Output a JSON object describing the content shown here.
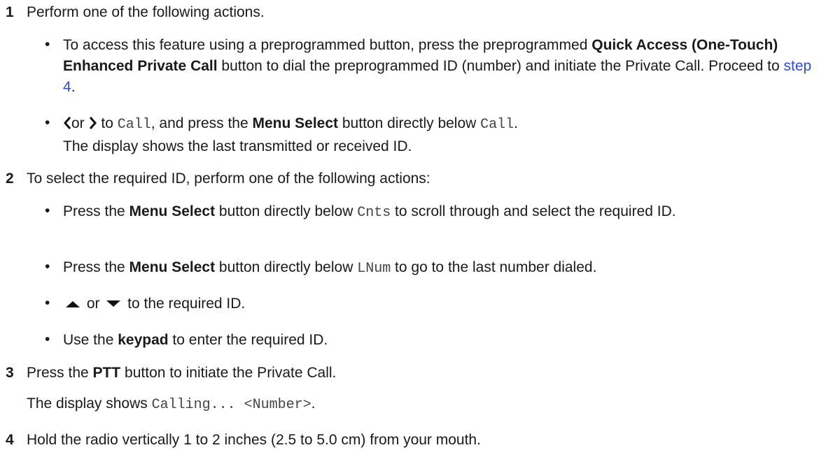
{
  "step1": {
    "number": "1",
    "text": "Perform one of the following actions.",
    "bullet1": {
      "pre": "To access this feature using a preprogrammed button, press the preprogrammed ",
      "bold": "Quick Access (One-Touch) Enhanced Private Call",
      "mid": " button to dial the preprogrammed ID (number) and initiate the Private Call. Proceed to ",
      "link": "step 4",
      "post": "."
    },
    "bullet2": {
      "or": "or",
      "to": " to ",
      "call_code": "Call",
      "mid": ", and press the ",
      "bold": "Menu Select",
      "post": " button directly below ",
      "call_code2": "Call",
      "end": ".",
      "line2": "The display shows the last transmitted or received ID."
    }
  },
  "step2": {
    "number": "2",
    "text": "To select the required ID, perform one of the following actions:",
    "bullet1": {
      "pre": "Press the ",
      "bold": "Menu Select",
      "mid": " button directly below ",
      "code": "Cnts",
      "post": " to scroll through and select the required ID."
    },
    "bullet2": {
      "pre": "Press the ",
      "bold": "Menu Select",
      "mid": " button directly below ",
      "code": "LNum",
      "post": " to go to the last number dialed."
    },
    "bullet3": {
      "or": " or ",
      "post": " to the required ID."
    },
    "bullet4": {
      "pre": "Use the ",
      "bold": "keypad",
      "post": " to enter the required ID."
    }
  },
  "step3": {
    "number": "3",
    "pre": "Press the ",
    "bold": "PTT",
    "post": " button to initiate the Private Call.",
    "display_pre": "The display shows ",
    "display_code": "Calling... <Number>",
    "display_end": "."
  },
  "step4": {
    "number": "4",
    "text": "Hold the radio vertically 1 to 2 inches (2.5 to 5.0 cm) from your mouth."
  },
  "bullet_char": "•"
}
